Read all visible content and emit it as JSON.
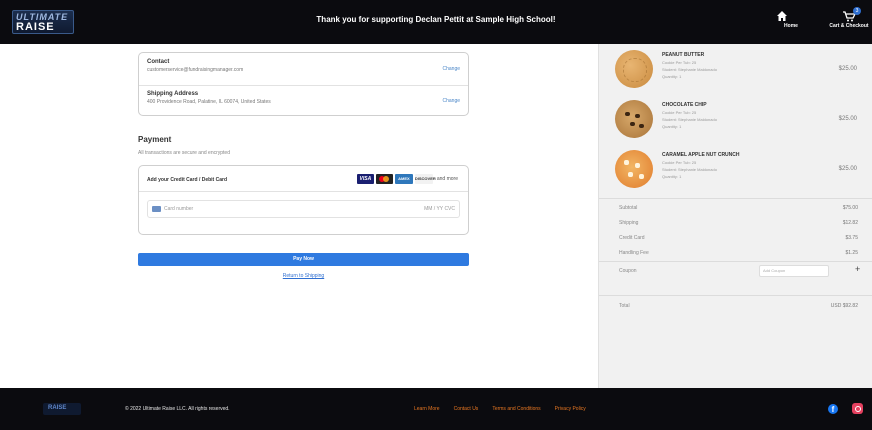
{
  "header": {
    "logo_top": "ULTIMATE",
    "logo_bottom": "RAISE",
    "message": "Thank you for supporting Declan Pettit at Sample High School!",
    "nav": {
      "home_label": "Home",
      "cart_label": "Cart & Checkout",
      "cart_count": "3"
    }
  },
  "checkout": {
    "contact": {
      "title": "Contact",
      "value": "customerservice@fundraisingmanager.com",
      "change": "Change"
    },
    "shipping": {
      "title": "Shipping Address",
      "value": "400 Providence Road, Palatine, IL 60074, United States",
      "change": "Change"
    },
    "payment": {
      "title": "Payment",
      "subtitle": "All transactions are secure and encrypted",
      "card_header": "Add your Credit Card / Debit Card",
      "brands": [
        "VISA",
        "",
        "AMEX",
        "DISCOVER"
      ],
      "brands_more": "and more",
      "card_placeholder": "Card number",
      "expiry_placeholder": "MM / YY  CVC"
    },
    "pay_button": "Pay Now",
    "return_link": "Return to Shipping"
  },
  "summary": {
    "items": [
      {
        "name": "PEANUT BUTTER",
        "meta1": "Cookie Per Tub: 25",
        "meta2": "Student: Stephanie Maldonado",
        "meta3": "Quantity: 1",
        "price": "$25.00",
        "icon": "peanut-butter-cookie"
      },
      {
        "name": "CHOCOLATE CHIP",
        "meta1": "Cookie Per Tub: 25",
        "meta2": "Student: Stephanie Maldonado",
        "meta3": "Quantity: 1",
        "price": "$25.00",
        "icon": "chocolate-chip-cookie"
      },
      {
        "name": "CARAMEL APPLE NUT CRUNCH",
        "meta1": "Cookie Per Tub: 25",
        "meta2": "Student: Stephanie Maldonado",
        "meta3": "Quantity: 1",
        "price": "$25.00",
        "icon": "caramel-apple-cookie"
      }
    ],
    "subtotal_label": "Subtotal",
    "subtotal": "$75.00",
    "shipping_label": "Shipping",
    "shipping": "$12.82",
    "credit_label": "Credit Card",
    "credit": "$3.75",
    "handling_label": "Handling Fee",
    "handling": "$1.25",
    "coupon_label": "Coupon",
    "coupon_placeholder": "Add Coupon",
    "coupon_add": "+",
    "total_label": "Total",
    "total": "USD $92.82"
  },
  "footer": {
    "logo": "RAISE",
    "copyright": "© 2022 Ultimate Raise LLC. All rights reserved.",
    "links": [
      "Learn More",
      "Contact Us",
      "Terms and Conditions",
      "Privacy Policy"
    ],
    "facebook": "f"
  },
  "colors": {
    "header_bg": "#0b0b0f",
    "accent_blue": "#2f7ae0",
    "footer_link": "#e87722",
    "summary_bg": "#f1f1f1"
  }
}
